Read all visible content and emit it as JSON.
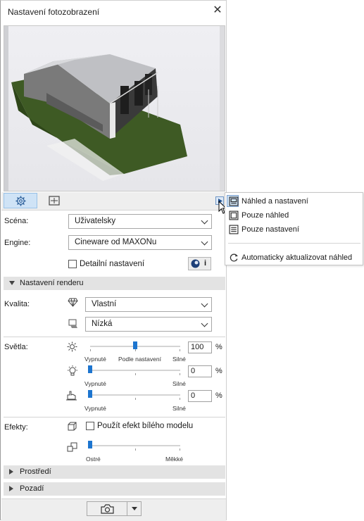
{
  "window": {
    "title": "Nastavení fotozobrazení",
    "close_icon": "close-icon"
  },
  "preview": {
    "image": "house-render-preview"
  },
  "tabs": [
    {
      "name": "settings-tab",
      "icon": "gear-icon",
      "selected": true
    },
    {
      "name": "size-tab",
      "icon": "frame-icon",
      "selected": false
    }
  ],
  "scene": {
    "label": "Scéna:",
    "value": "Uživatelsky"
  },
  "engine": {
    "label": "Engine:",
    "value": "Cineware od MAXONu",
    "detail_label": "Detailní nastavení",
    "detail_checked": false
  },
  "render_section": {
    "title": "Nastavení renderu"
  },
  "quality": {
    "label": "Kvalita:",
    "value1": "Vlastní",
    "value2": "Nízká"
  },
  "lights": {
    "label": "Světla:",
    "sun": {
      "value": "100",
      "pct": "%",
      "min": "Vypnuté",
      "mid": "Podle nastavení",
      "max": "Silné",
      "level": 0.5
    },
    "lamp": {
      "value": "0",
      "pct": "%",
      "min": "Vypnuté",
      "max": "Silné",
      "level": 0.0
    },
    "hand": {
      "value": "0",
      "pct": "%",
      "min": "Vypnuté",
      "max": "Silné",
      "level": 0.0
    }
  },
  "effects": {
    "label": "Efekty:",
    "white_model_label": "Použít efekt bílého modelu",
    "white_model_checked": false,
    "min": "Ostré",
    "max": "Měkké",
    "level": 0.0
  },
  "env_section": {
    "title": "Prostředí"
  },
  "bg_section": {
    "title": "Pozadí"
  },
  "menu": {
    "items": [
      {
        "label": "Náhled a nastavení",
        "checked": true
      },
      {
        "label": "Pouze náhled"
      },
      {
        "label": "Pouze nastavení"
      }
    ],
    "auto_update": "Automaticky aktualizovat náhled"
  },
  "colors": {
    "accent": "#1d75cf",
    "tab_selected": "#cfe3f6",
    "section_bg": "#e3e3e3"
  }
}
